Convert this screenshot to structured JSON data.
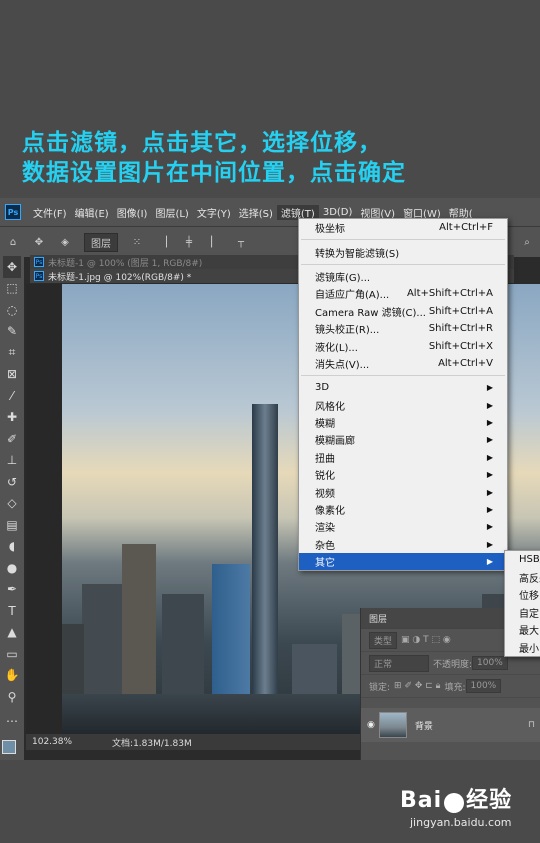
{
  "caption": {
    "line1": "点击滤镜，点击其它，选择位移，",
    "line2": "数据设置图片在中间位置，点击确定"
  },
  "app": {
    "logo": "Ps",
    "menubar": [
      "文件(F)",
      "编辑(E)",
      "图像(I)",
      "图层(L)",
      "文字(Y)",
      "选择(S)",
      "滤镜(T)",
      "3D(D)",
      "视图(V)",
      "窗口(W)",
      "帮助("
    ],
    "options": {
      "layer_select": "图层"
    },
    "tabs": [
      {
        "label": "未标题-1 @ 100% (图层 1, RGB/8#)"
      },
      {
        "label": "未标题-1.jpg @ 102%(RGB/8#) *"
      }
    ],
    "status": {
      "zoom": "102.38%",
      "doc": "文档:1.83M/1.83M"
    }
  },
  "filter_menu": {
    "items": [
      {
        "label": "极坐标",
        "shortcut": "Alt+Ctrl+F"
      },
      {
        "sep": true
      },
      {
        "label": "转换为智能滤镜(S)",
        "shortcut": ""
      },
      {
        "sep": true
      },
      {
        "label": "滤镜库(G)...",
        "shortcut": ""
      },
      {
        "label": "自适应广角(A)...",
        "shortcut": "Alt+Shift+Ctrl+A"
      },
      {
        "label": "Camera Raw 滤镜(C)...",
        "shortcut": "Shift+Ctrl+A"
      },
      {
        "label": "镜头校正(R)...",
        "shortcut": "Shift+Ctrl+R"
      },
      {
        "label": "液化(L)...",
        "shortcut": "Shift+Ctrl+X"
      },
      {
        "label": "消失点(V)...",
        "shortcut": "Alt+Ctrl+V"
      },
      {
        "sep": true
      },
      {
        "label": "3D",
        "sub": true
      },
      {
        "label": "风格化",
        "sub": true
      },
      {
        "label": "模糊",
        "sub": true
      },
      {
        "label": "模糊画廊",
        "sub": true
      },
      {
        "label": "扭曲",
        "sub": true
      },
      {
        "label": "锐化",
        "sub": true
      },
      {
        "label": "视频",
        "sub": true
      },
      {
        "label": "像素化",
        "sub": true
      },
      {
        "label": "渲染",
        "sub": true
      },
      {
        "label": "杂色",
        "sub": true
      },
      {
        "label": "其它",
        "sub": true,
        "highlighted": true
      }
    ]
  },
  "other_submenu": [
    "HSB/",
    "高反差",
    "位移...",
    "自定",
    "最大",
    "最小"
  ],
  "layers_panel": {
    "title": "图层",
    "kind": "类型",
    "blend": "正常",
    "opacity_label": "不透明度:",
    "opacity": "100%",
    "lock_label": "锁定:",
    "fill_label": "填充:",
    "fill": "100%",
    "layer_name": "背景"
  },
  "watermark": {
    "brand": "Bai",
    "brand2": "经验",
    "url": "jingyan.baidu.com"
  }
}
